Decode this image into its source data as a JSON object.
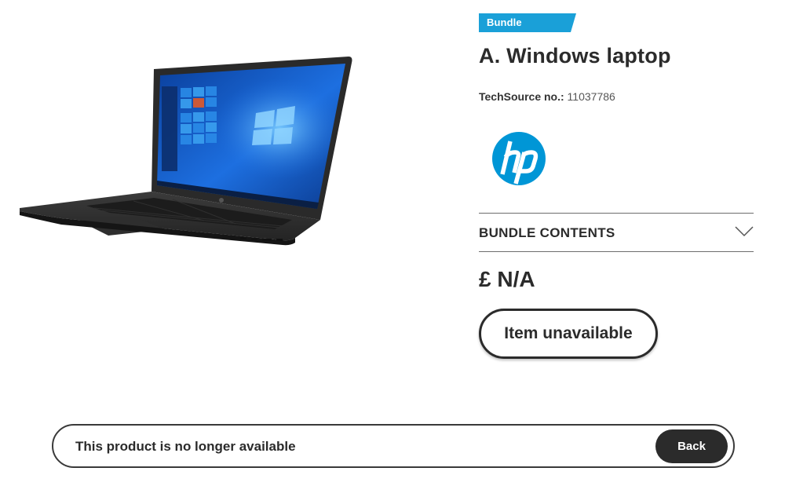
{
  "product": {
    "badge": "Bundle",
    "title": "A. Windows laptop",
    "sku_label": "TechSource no.:",
    "sku_value": "11037786",
    "brand_logo": "hp-logo",
    "image": "laptop-image"
  },
  "bundle_contents": {
    "label": "BUNDLE CONTENTS",
    "icon": "chevron-down-icon"
  },
  "price": "£ N/A",
  "unavailable_button": "Item unavailable",
  "notice": {
    "message": "This product is no longer available",
    "back_label": "Back"
  },
  "colors": {
    "badge": "#1aa0d8",
    "text": "#2b2b2b",
    "hp_blue": "#0096d6",
    "back_button": "#2b2b2b"
  }
}
